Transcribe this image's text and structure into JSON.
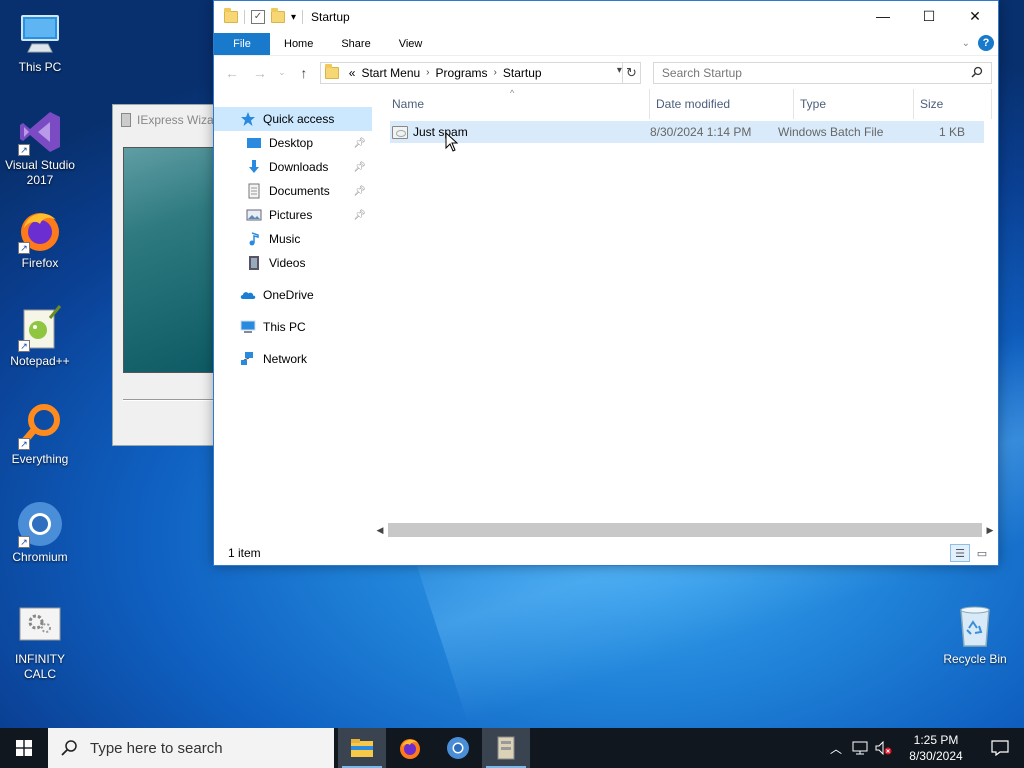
{
  "desktop": {
    "icons": [
      {
        "label": "This PC"
      },
      {
        "label": "Visual Studio 2017"
      },
      {
        "label": "Firefox"
      },
      {
        "label": "Notepad++"
      },
      {
        "label": "Everything"
      },
      {
        "label": "Chromium"
      },
      {
        "label": "INFINITY CALC"
      },
      {
        "label": "Recycle Bin"
      }
    ]
  },
  "background_window": {
    "title": "IExpress Wiza"
  },
  "explorer": {
    "title": "Startup",
    "window_buttons": {
      "minimize": "—",
      "maximize": "☐",
      "close": "✕"
    },
    "ribbon": {
      "tabs": [
        "File",
        "Home",
        "Share",
        "View"
      ],
      "help": "?"
    },
    "address": {
      "overflow": "«",
      "crumbs": [
        "Start Menu",
        "Programs",
        "Startup"
      ]
    },
    "search": {
      "placeholder": "Search Startup"
    },
    "nav": {
      "quick_access": "Quick access",
      "pinned": [
        "Desktop",
        "Downloads",
        "Documents",
        "Pictures"
      ],
      "unpinned": [
        "Music",
        "Videos"
      ],
      "onedrive": "OneDrive",
      "this_pc": "This PC",
      "network": "Network"
    },
    "columns": {
      "name": "Name",
      "date": "Date modified",
      "type": "Type",
      "size": "Size"
    },
    "files": [
      {
        "name": "Just spam",
        "date": "8/30/2024 1:14 PM",
        "type": "Windows Batch File",
        "size": "1 KB"
      }
    ],
    "status": "1 item"
  },
  "taskbar": {
    "search_placeholder": "Type here to search",
    "time": "1:25 PM",
    "date": "8/30/2024"
  },
  "colors": {
    "accent": "#1979ca",
    "selection": "#cce8ff",
    "taskbar": "#10171f"
  }
}
